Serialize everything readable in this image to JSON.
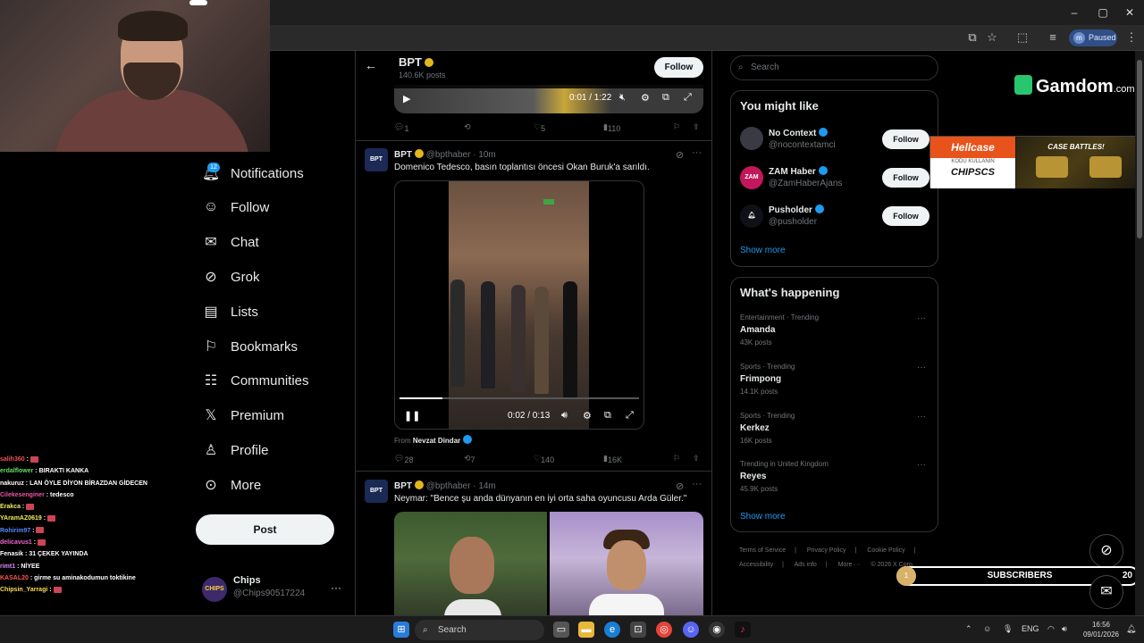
{
  "browser": {
    "paused_label": "Paused",
    "profile_initial": "m"
  },
  "nav": {
    "notifications_badge": "12",
    "items": [
      {
        "label": "Notifications",
        "icon": "bell-icon"
      },
      {
        "label": "Follow",
        "icon": "person-plus-icon"
      },
      {
        "label": "Chat",
        "icon": "mail-icon"
      },
      {
        "label": "Grok",
        "icon": "grok-icon"
      },
      {
        "label": "Lists",
        "icon": "list-icon"
      },
      {
        "label": "Bookmarks",
        "icon": "bookmark-icon"
      },
      {
        "label": "Communities",
        "icon": "people-icon"
      },
      {
        "label": "Premium",
        "icon": "x-logo-icon"
      },
      {
        "label": "Profile",
        "icon": "person-icon"
      },
      {
        "label": "More",
        "icon": "more-circle-icon"
      }
    ],
    "post_label": "Post",
    "profile": {
      "name": "Chips",
      "handle": "@Chips90517224",
      "avatar_text": "CHIPS"
    }
  },
  "chat": [
    {
      "user": "salih360",
      "msg": ""
    },
    {
      "user": "erdalflower",
      "msg": "BIRAKTI KANKA"
    },
    {
      "user": "nakuruz",
      "msg": "LAN ÖYLE DİYON BİRAZDAN GİDECEN"
    },
    {
      "user": "Cilekesenginer",
      "msg": "tedesco"
    },
    {
      "user": "Erakca",
      "msg": ""
    },
    {
      "user": "YAramAZ0619",
      "msg": ""
    },
    {
      "user": "Rohirim97",
      "msg": ""
    },
    {
      "user": "delicavus1",
      "msg": ""
    },
    {
      "user": "Fenasik",
      "msg": "31 ÇEKEK YAYINDA"
    },
    {
      "user": "rimt1",
      "msg": "NİYEE"
    },
    {
      "user": "KASAL20",
      "msg": "girme su aminakodumun toktikine"
    },
    {
      "user": "Chipsin_Yarragi",
      "msg": ""
    }
  ],
  "feed": {
    "header": {
      "name": "BPT",
      "posts": "140.6K posts",
      "follow_label": "Follow"
    },
    "mini_player": {
      "time": "0:01 / 1:22"
    },
    "first_actions": {
      "replies": "1",
      "likes": "5",
      "views": "110"
    },
    "tweet1": {
      "avatar": "BPT",
      "name": "BPT",
      "handle": "@bpthaber",
      "age": "10m",
      "text": "Domenico Tedesco, basın toplantısı öncesi Okan Buruk'a sarıldı.",
      "video_time": "0:02 / 0:13",
      "video_progress": 0.18,
      "from_label": "From",
      "from_name": "Nevzat Dindar",
      "replies": "28",
      "reposts": "7",
      "likes": "140",
      "views": "16K"
    },
    "tweet2": {
      "avatar": "BPT",
      "name": "BPT",
      "handle": "@bpthaber",
      "age": "14m",
      "text": "Neymar: \"Bence şu anda dünyanın en iyi orta saha oyuncusu Arda Güler.\""
    }
  },
  "right": {
    "search_placeholder": "Search",
    "you_might_like": {
      "title": "You might like",
      "accounts": [
        {
          "name": "No Context",
          "handle": "@nocontextamci",
          "follow": "Follow",
          "avatar": "",
          "color": "#3a3a44"
        },
        {
          "name": "ZAM Haber",
          "handle": "@ZamHaberAjans",
          "follow": "Follow",
          "avatar": "ZAM",
          "color": "#c2185b"
        },
        {
          "name": "Pusholder",
          "handle": "@pusholder",
          "follow": "Follow",
          "avatar": "",
          "color": "#101018"
        }
      ],
      "show_more": "Show more"
    },
    "whats_happening": {
      "title": "What's happening",
      "trends": [
        {
          "category": "Entertainment · Trending",
          "name": "Amanda",
          "count": "43K posts"
        },
        {
          "category": "Sports · Trending",
          "name": "Frimpong",
          "count": "14.1K posts"
        },
        {
          "category": "Sports · Trending",
          "name": "Kerkez",
          "count": "16K posts"
        },
        {
          "category": "Trending in United Kingdom",
          "name": "Reyes",
          "count": "45.9K posts"
        }
      ],
      "show_more": "Show more"
    },
    "footer": [
      "Terms of Service",
      "|",
      "Privacy Policy",
      "|",
      "Cookie Policy",
      "|",
      "Accessibility",
      "|",
      "Ads info",
      "|",
      "More ···",
      "© 2026 X Corp."
    ]
  },
  "overlays": {
    "gamdom": {
      "name": "Gamdom",
      "tld": ".com"
    },
    "hellcase": {
      "brand": "Hellcase",
      "kodu": "KODU KULLANIN",
      "code": "CHIPSCS",
      "cta": "CASE BATTLES!"
    },
    "subscribers": {
      "label": "SUBSCRIBERS",
      "count": "20",
      "coin": "1"
    }
  },
  "taskbar": {
    "search_label": "Search",
    "lang": "ENG",
    "time": "16:56",
    "date": "09/01/2026"
  }
}
